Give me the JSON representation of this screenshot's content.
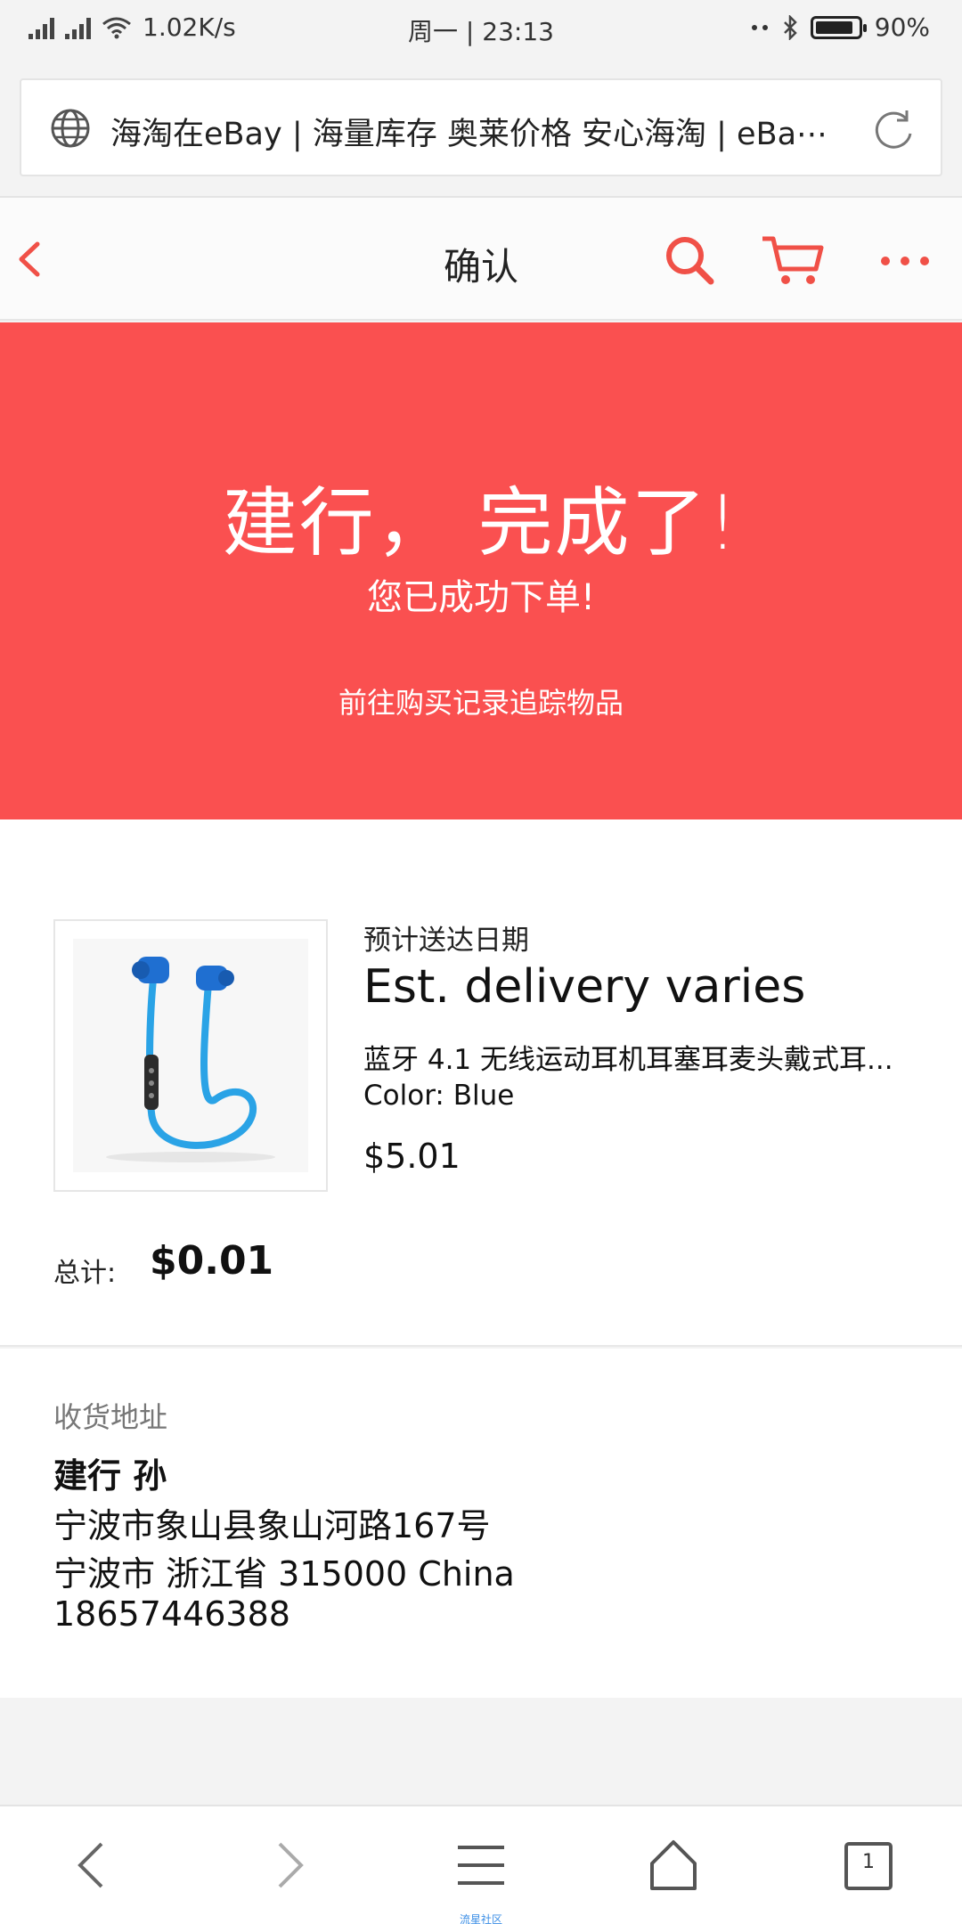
{
  "status_bar": {
    "network_speed": "1.02K/s",
    "datetime": "周一 | 23:13",
    "battery": "90%",
    "battery_level": 0.9,
    "icons": [
      "signal-icon",
      "signal-icon",
      "wifi-icon",
      "dots-icon",
      "bluetooth-icon",
      "battery-icon"
    ]
  },
  "browser": {
    "page_title": "海淘在eBay | 海量库存 奥莱价格 安心海淘 | eBa⋯",
    "icons": [
      "globe-icon",
      "reload-icon"
    ]
  },
  "header": {
    "title": "确认",
    "icons": [
      "back-chevron-icon",
      "search-icon",
      "cart-icon",
      "more-icon"
    ],
    "accent_color": "#f05047"
  },
  "hero": {
    "title": "建行， 完成了!",
    "subtitle": "您已成功下单!",
    "link": "前往购买记录追踪物品",
    "background_color": "#fa5050"
  },
  "order": {
    "est_label": "预计送达日期",
    "est_value": "Est. delivery varies",
    "product_name": "蓝牙 4.1 无线运动耳机耳塞耳麦头戴式耳...",
    "color": "Color: Blue",
    "price": "$5.01",
    "total_label": "总计:",
    "total_value": "$0.01",
    "product_image": "blue-wireless-earphones"
  },
  "shipping": {
    "heading": "收货地址",
    "name": "建行 孙",
    "line1": "宁波市象山县象山河路167号",
    "line2": "宁波市 浙江省 315000 China",
    "phone": "18657446388"
  },
  "bottom_nav": {
    "icons": [
      "back-icon",
      "forward-icon",
      "menu-icon",
      "home-icon",
      "tabs-icon"
    ],
    "tab_count": "1",
    "caption": "流星社区"
  }
}
